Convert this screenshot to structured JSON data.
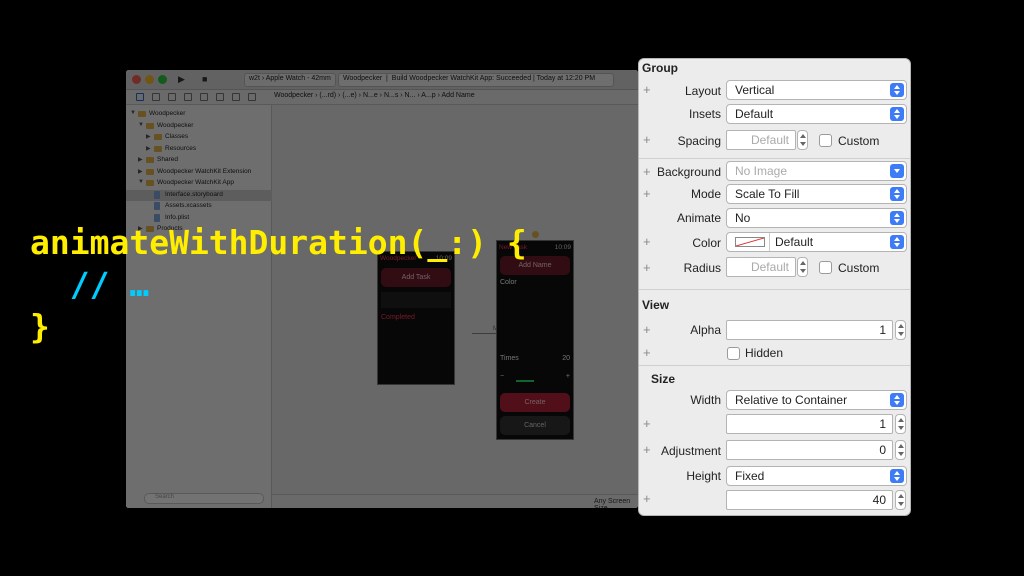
{
  "code": {
    "line1": "animateWithDuration(_:) {",
    "line2_comment": "  // …",
    "line3": "}"
  },
  "xcode": {
    "scheme": "w2t › Apple Watch - 42mm",
    "scheme_target": "Woodpecker",
    "status": "Build Woodpecker WatchKit App: Succeeded | Today at 12:20 PM",
    "jump_bar": "Woodpecker  ›  (...rd)  ›  (...e)  ›  N...e  ›  N...s  ›  N...  ›  A...p  ›  Add Name",
    "navigator": [
      {
        "label": "Woodpecker",
        "level": 0,
        "kind": "project"
      },
      {
        "label": "Woodpecker",
        "level": 1,
        "kind": "folder"
      },
      {
        "label": "Classes",
        "level": 2,
        "kind": "folder"
      },
      {
        "label": "Resources",
        "level": 2,
        "kind": "folder"
      },
      {
        "label": "Shared",
        "level": 1,
        "kind": "folder"
      },
      {
        "label": "Woodpecker WatchKit Extension",
        "level": 1,
        "kind": "folder"
      },
      {
        "label": "Woodpecker WatchKit App",
        "level": 1,
        "kind": "folder"
      },
      {
        "label": "Interface.storyboard",
        "level": 2,
        "kind": "file",
        "selected": true
      },
      {
        "label": "Assets.xcassets",
        "level": 2,
        "kind": "file"
      },
      {
        "label": "Info.plist",
        "level": 2,
        "kind": "file"
      },
      {
        "label": "Products",
        "level": 1,
        "kind": "folder"
      }
    ],
    "search_placeholder": "Search",
    "screen_size": "Any Screen Size",
    "entry_label": "Main",
    "watch1": {
      "title": "Woodpecker",
      "time": "10:09",
      "add_task": "Add Task",
      "completed": "Completed"
    },
    "watch2": {
      "title": "New Task",
      "time": "10:09",
      "add_name": "Add Name",
      "color": "Color",
      "times": "Times",
      "times_value": "20",
      "minus": "−",
      "plus": "+",
      "create": "Create",
      "cancel": "Cancel"
    }
  },
  "inspector": {
    "group": {
      "title": "Group",
      "layout_label": "Layout",
      "layout_value": "Vertical",
      "insets_label": "Insets",
      "insets_value": "Default",
      "spacing_label": "Spacing",
      "spacing_placeholder": "Default",
      "spacing_custom": "Custom",
      "background_label": "Background",
      "background_placeholder": "No Image",
      "mode_label": "Mode",
      "mode_value": "Scale To Fill",
      "animate_label": "Animate",
      "animate_value": "No",
      "color_label": "Color",
      "color_value": "Default",
      "radius_label": "Radius",
      "radius_placeholder": "Default",
      "radius_custom": "Custom"
    },
    "view": {
      "title": "View",
      "alpha_label": "Alpha",
      "alpha_value": "1",
      "hidden_label": "Hidden"
    },
    "size": {
      "title": "Size",
      "width_label": "Width",
      "width_value": "Relative to Container",
      "width_number": "1",
      "adjustment_label": "Adjustment",
      "adjustment_value": "0",
      "height_label": "Height",
      "height_value": "Fixed",
      "height_number": "40"
    },
    "plus": "+"
  },
  "colors": {
    "code_yellow": "#ffee00",
    "code_comment": "#00ccff",
    "accent_blue": "#3d7cf6",
    "watch_red": "#ff3b5c"
  }
}
